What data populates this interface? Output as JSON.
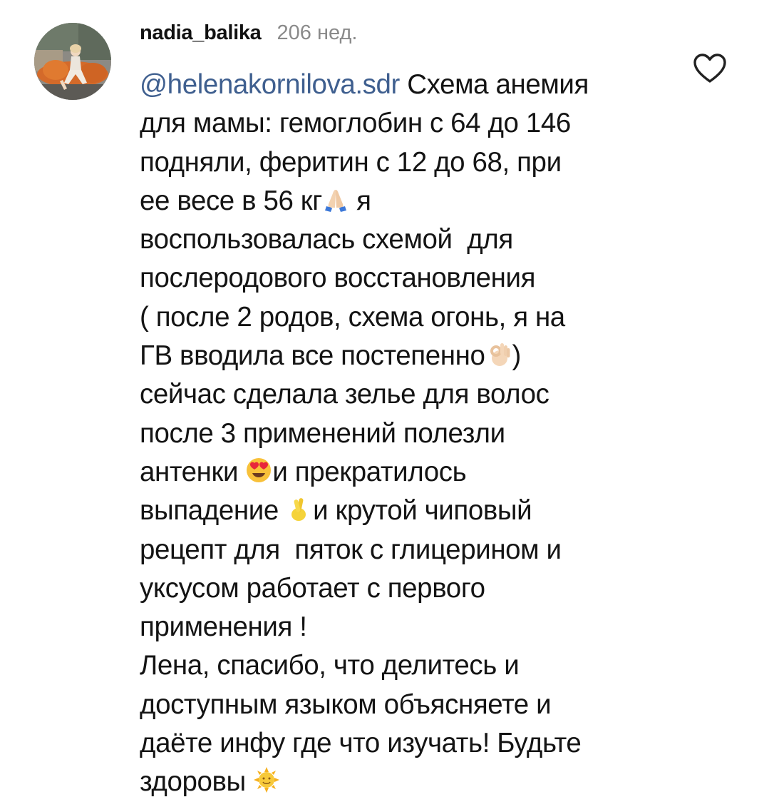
{
  "comment": {
    "username": "nadia_balika",
    "time": "206 нед.",
    "mention": "@helenakornilova.sdr",
    "lines": [
      " Схема анемия",
      "для мамы: гемоглобин с 64 до 146",
      "подняли, феритин с 12 до 68, при",
      "ее весе в 56 кг",
      " я",
      "воспользовалась схемой  для",
      "послеродового восстановления",
      "( после 2 родов, схема огонь, я на",
      "ГВ вводила все постепенно",
      ")",
      "сейчас сделала зелье для волос",
      "после 3 применений полезли",
      "антенки ",
      "и прекратилось",
      "выпадение ",
      "и крутой чиповый",
      "рецепт для  пяток с глицерином и",
      "уксусом работает с первого",
      "применения !",
      "Лена, спасибо, что делитесь и",
      "доступным языком объясняете и",
      "даёте инфу где что изучать! Будьте",
      "здоровы "
    ],
    "emojis": {
      "pray": "folded-hands-icon",
      "ok": "ok-hand-icon",
      "love": "heart-eyes-icon",
      "fingers": "crossed-fingers-icon",
      "sun": "sun-face-icon"
    }
  },
  "colors": {
    "mention": "#3f5f8f",
    "time": "#8a8a8a",
    "text": "#141414"
  }
}
